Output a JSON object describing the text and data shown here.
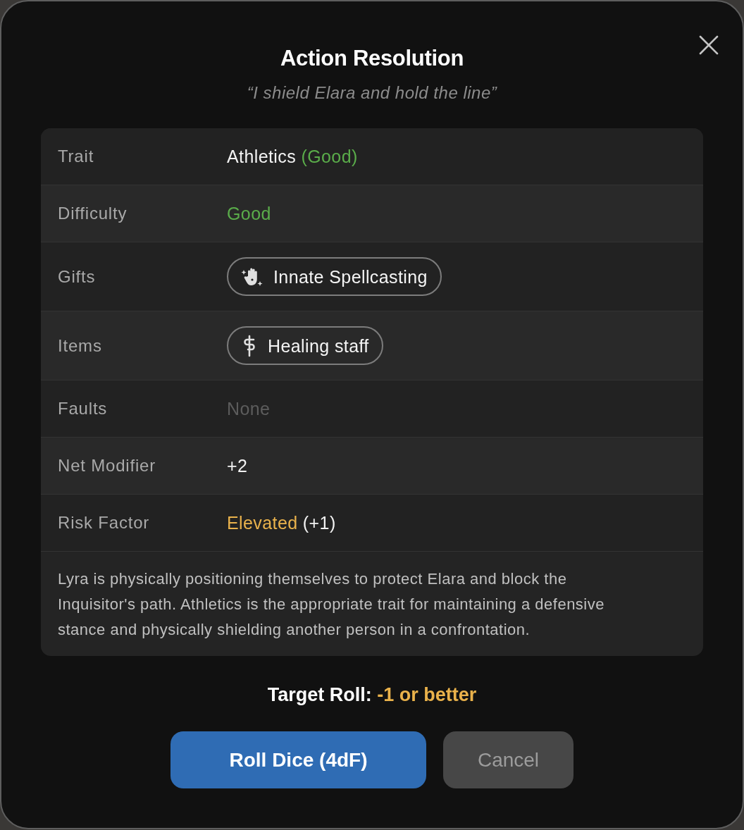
{
  "dialog": {
    "title": "Action Resolution",
    "subtitle": "“I shield Elara and hold the line”"
  },
  "rows": [
    {
      "label": "Trait",
      "kind": "text",
      "parts": [
        {
          "text": "Athletics",
          "color": "#f2f2f2"
        },
        {
          "text": "(Good)",
          "color": "#5aac4a"
        }
      ]
    },
    {
      "label": "Difficulty",
      "kind": "text",
      "parts": [
        {
          "text": "Good",
          "color": "#5aac4a"
        }
      ]
    },
    {
      "label": "Gifts",
      "kind": "chips",
      "chips": [
        {
          "label": "Innate Spellcasting",
          "kind": "gift"
        }
      ]
    },
    {
      "label": "Items",
      "kind": "chips",
      "chips": [
        {
          "label": "Healing staff",
          "kind": "item"
        }
      ]
    },
    {
      "label": "Faults",
      "kind": "text",
      "parts": [
        {
          "text": "None",
          "color": "#5c5c5c"
        }
      ]
    },
    {
      "label": "Net Modifier",
      "kind": "text",
      "parts": [
        {
          "text": "+2",
          "color": "#f2f2f2"
        }
      ]
    },
    {
      "label": "Risk Factor",
      "kind": "text",
      "parts": [
        {
          "text": "Elevated",
          "color": "#e9b24c"
        },
        {
          "text": "(+1)",
          "color": "#f2f2f2"
        }
      ]
    }
  ],
  "description": "Lyra is physically positioning themselves to protect Elara and block the Inquisitor's path. Athletics is the appropriate trait for maintaining a defensive stance and physically shielding another person in a confrontation.",
  "target_roll": {
    "label": "Target Roll:",
    "value": "-1 or better"
  },
  "buttons": [
    {
      "label": "Roll Dice (4dF)",
      "kind": "primary"
    },
    {
      "label": "Cancel",
      "kind": "secondary"
    }
  ]
}
